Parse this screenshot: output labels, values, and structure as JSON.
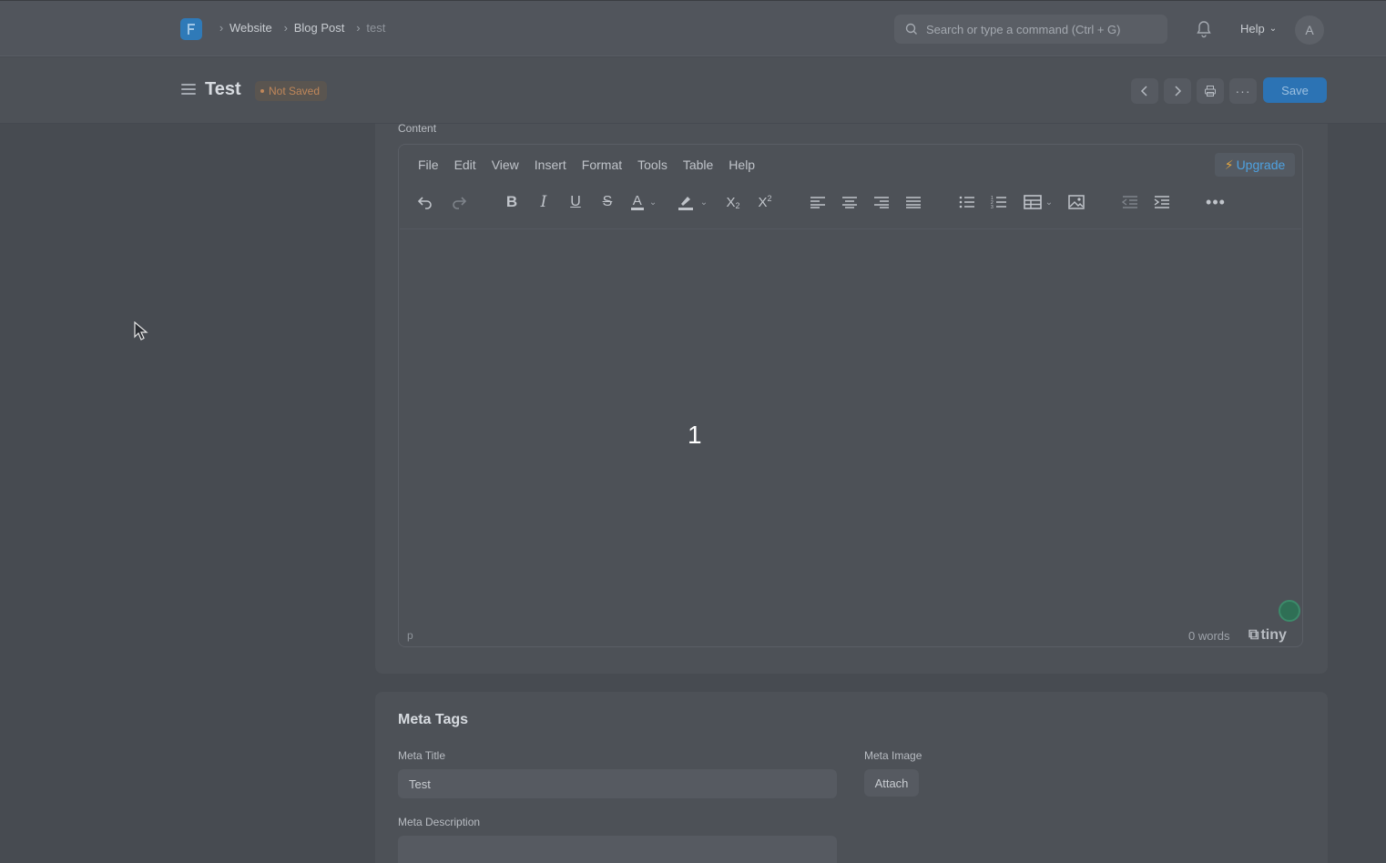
{
  "topbar": {
    "breadcrumbs": [
      "Website",
      "Blog Post",
      "test"
    ],
    "search_placeholder": "Search or type a command (Ctrl + G)",
    "help_label": "Help",
    "avatar_initial": "A"
  },
  "header": {
    "title": "Test",
    "status_badge": "Not Saved",
    "save_label": "Save"
  },
  "editor": {
    "field_label": "Content",
    "menu": [
      "File",
      "Edit",
      "View",
      "Insert",
      "Format",
      "Tools",
      "Table",
      "Help"
    ],
    "upgrade_label": "Upgrade",
    "body_text": "1",
    "path": "p",
    "word_count": "0 words",
    "brand": "tiny"
  },
  "meta": {
    "heading": "Meta Tags",
    "meta_title_label": "Meta Title",
    "meta_title_value": "Test",
    "meta_image_label": "Meta Image",
    "attach_label": "Attach",
    "meta_description_label": "Meta Description"
  },
  "colors": {
    "accent": "#2c73b4",
    "upgrade": "#4ea1e0",
    "not_saved": "#c0875a"
  }
}
